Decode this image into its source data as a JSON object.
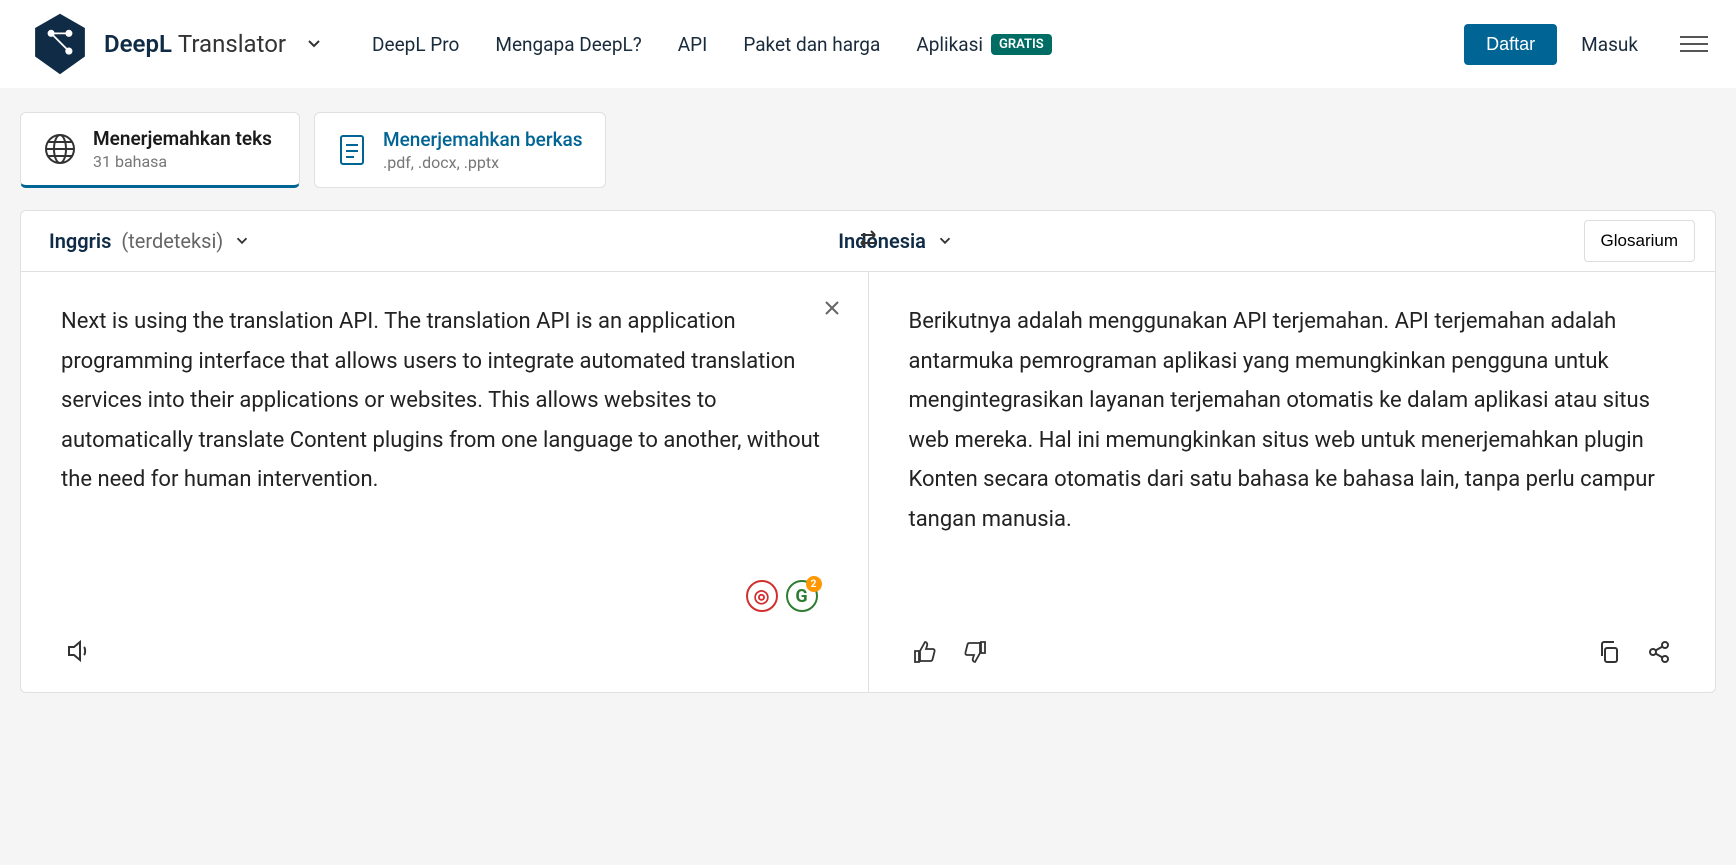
{
  "header": {
    "brand_bold": "DeepL",
    "brand_light": "Translator",
    "nav": {
      "pro": "DeepL Pro",
      "why": "Mengapa DeepL?",
      "api": "API",
      "pricing": "Paket dan harga",
      "apps": "Aplikasi",
      "free_badge": "GRATIS"
    },
    "cta_signup": "Daftar",
    "login": "Masuk"
  },
  "tabs": {
    "text": {
      "title": "Menerjemahkan teks",
      "sub": "31 bahasa"
    },
    "files": {
      "title": "Menerjemahkan berkas",
      "sub": ".pdf, .docx, .pptx"
    }
  },
  "langbar": {
    "source_lang": "Inggris",
    "source_detected": "(terdeteksi)",
    "target_lang": "Indonesia",
    "glossary": "Glosarium"
  },
  "source_text": "Next is using the translation API. The translation API is an application programming interface that allows users to integrate automated translation services into their applications or websites. This allows websites to automatically translate Content plugins from one language to another, without the need for human intervention.",
  "target_text": "Berikutnya adalah menggunakan API terjemahan. API terjemahan adalah antarmuka pemrograman aplikasi yang memungkinkan pengguna untuk mengintegrasikan layanan terjemahan otomatis ke dalam aplikasi atau situs web mereka. Hal ini memungkinkan situs web untuk menerjemahkan plugin Konten secara otomatis dari satu bahasa ke bahasa lain, tanpa perlu campur tangan manusia.",
  "ext": {
    "grammarly_count": "2"
  }
}
